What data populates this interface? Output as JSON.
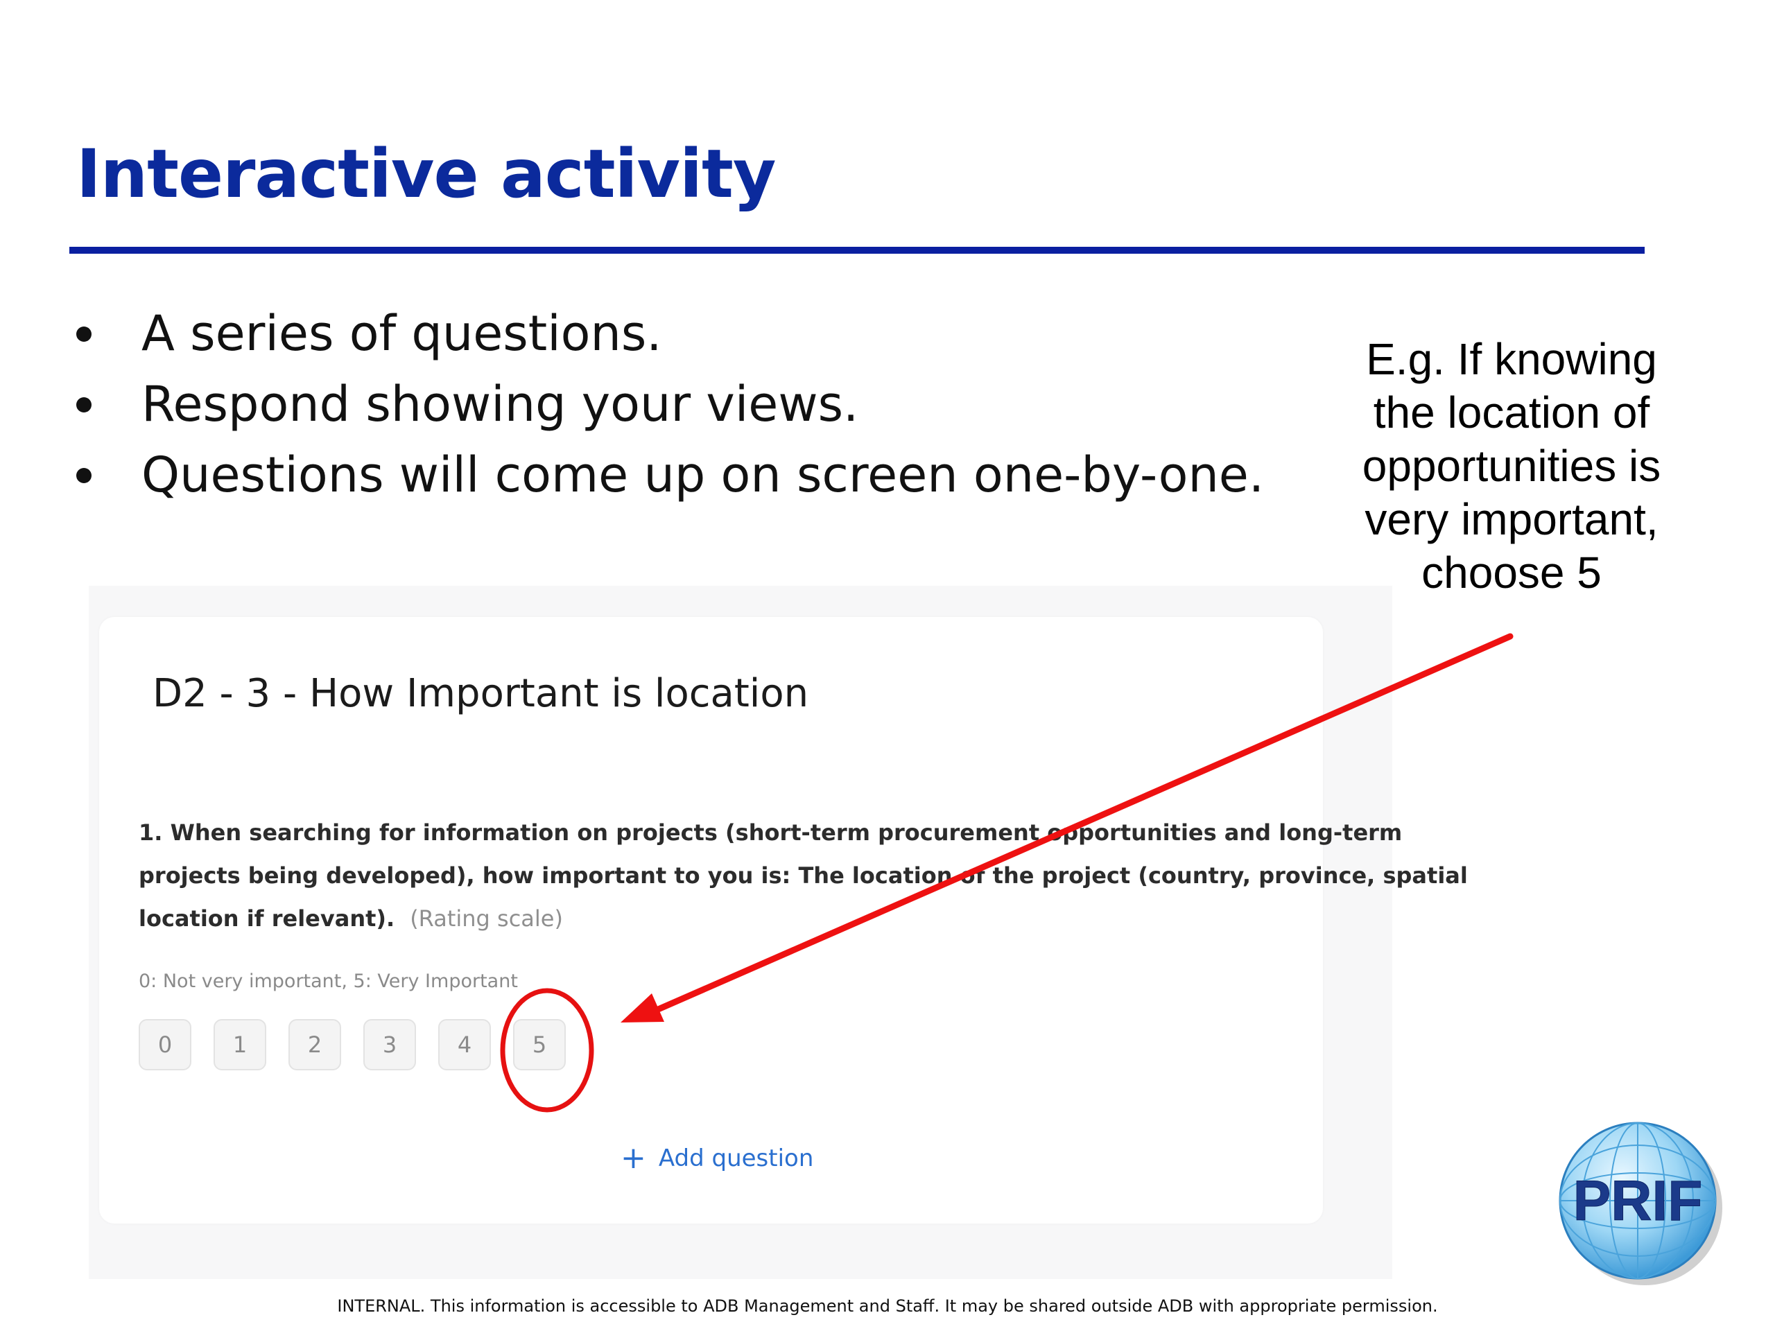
{
  "slide": {
    "title": "Interactive activity",
    "bullets": [
      "A series of questions.",
      "Respond showing your views.",
      "Questions will come up on screen one-by-one."
    ],
    "example_lines": [
      "E.g. If knowing",
      "the location of",
      "opportunities is",
      "very important,",
      "choose 5"
    ],
    "footer": "INTERNAL. This information is accessible to ADB Management and Staff. It may be shared outside ADB with appropriate permission."
  },
  "survey": {
    "question_title": "D2 - 3 - How Important is location",
    "question_lines": [
      "1.  When searching for information on projects (short-term procurement opportunities and long-term",
      "projects being developed), how important to you is: The location of the project (country, province, spatial",
      "location if relevant)."
    ],
    "question_type": "(Rating scale)",
    "scale_hint": "0: Not very important, 5: Very Important",
    "rating_options": [
      "0",
      "1",
      "2",
      "3",
      "4",
      "5"
    ],
    "add_question_label": "Add question"
  },
  "logo": {
    "text": "PRIF"
  },
  "colors": {
    "title": "#0b2a9c",
    "rule": "#0a1fa0",
    "annotation": "#ee1111",
    "link": "#2a6fcf"
  }
}
